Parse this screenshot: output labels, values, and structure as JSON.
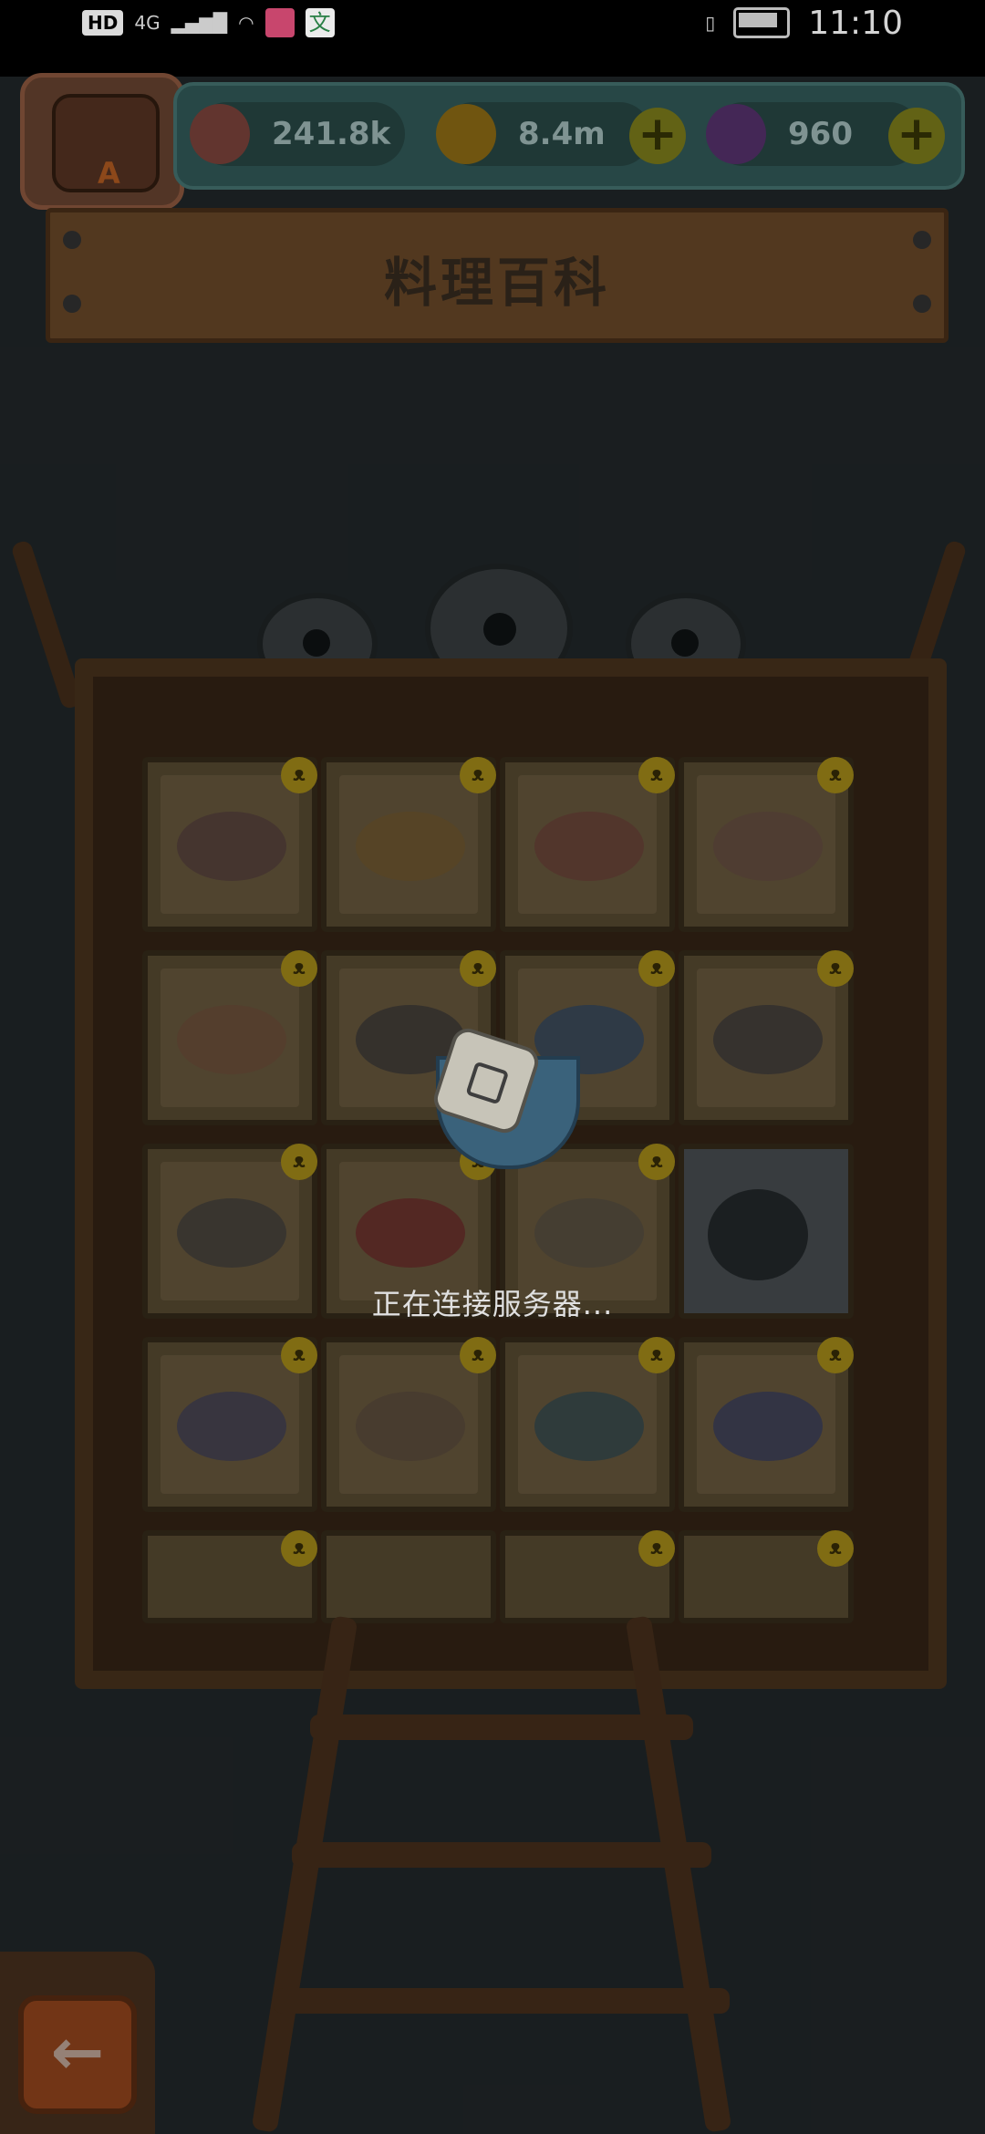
{
  "status_bar": {
    "hd": "HD",
    "network": "4G",
    "time": "11:10",
    "app_icon_text": "文"
  },
  "resources": {
    "eyes": "241.8k",
    "coins": "8.4m",
    "potion": "960",
    "plus_symbol": "+"
  },
  "avatar": {
    "letter": "A"
  },
  "title": "料理百科",
  "grid": {
    "rows": [
      [
        "dish",
        "dish",
        "dish",
        "dish"
      ],
      [
        "dish",
        "dish",
        "dish",
        "dish"
      ],
      [
        "dish",
        "dish",
        "dish",
        "locked"
      ],
      [
        "dish",
        "dish",
        "dish",
        "dish"
      ],
      [
        "dish",
        "dish",
        "dish",
        "dish"
      ]
    ]
  },
  "loading": {
    "text": "正在连接服务器..."
  },
  "back_button": {
    "icon": "←"
  },
  "colors": {
    "wall": "#1c2123",
    "plank": "#5a3d22",
    "resource_bar": "#2b4e4c",
    "plus": "#6b6b17"
  }
}
